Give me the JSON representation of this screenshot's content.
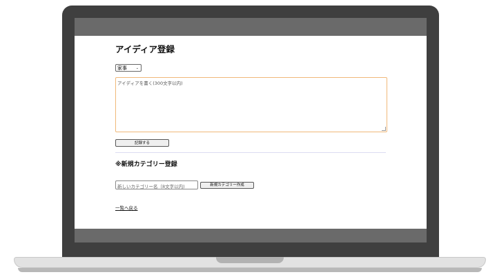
{
  "page": {
    "title": "アイディア登録",
    "category_select": {
      "selected": "家事"
    },
    "idea_textarea": {
      "placeholder": "アイディアを書く(300文字以内)"
    },
    "record_button_label": "記録する",
    "new_category_section": {
      "title": "※新規カテゴリー登録",
      "input_placeholder": "新しいカテゴリー名（8文字以内)",
      "create_button_label": "新規カテゴリー作成"
    },
    "back_link_label": "一覧へ戻る"
  },
  "icons": {
    "select_chevron": "chevron-down-icon",
    "textarea_resize": "resize-grip-icon"
  }
}
